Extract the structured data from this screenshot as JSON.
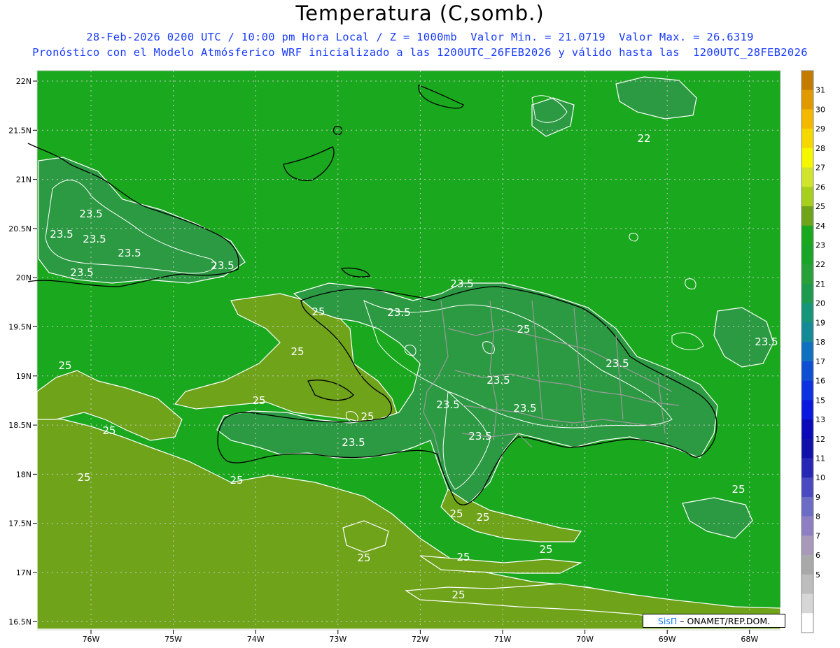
{
  "title": "Temperatura (C,somb.)",
  "subtitle_line1": "28-Feb-2026 0200 UTC / 10:00 pm Hora Local / Z = 1000mb  Valor Min. = 21.0719  Valor Max. = 26.6319",
  "subtitle_line2": "Pronóstico con el Modelo Atmósferico WRF inicializado a las 1200UTC_26FEB2026 y válido hasta las  1200UTC_28FEB2026",
  "credit": {
    "brand": "SisΠ",
    "separator": "– ",
    "org": "ONAMET/REP.DOM."
  },
  "colors": {
    "field_base": "#1aa81e",
    "field_warm": "#6fa31a",
    "field_cool": "#27a038",
    "land_cool": "#2b9a42",
    "title_blue": "#1a3cff"
  },
  "axes": {
    "lat_labels": [
      "22N",
      "21.5N",
      "21N",
      "20.5N",
      "20N",
      "19.5N",
      "19N",
      "18.5N",
      "18N",
      "17.5N",
      "17N",
      "16.5N"
    ],
    "lon_labels": [
      "76W",
      "75W",
      "74W",
      "73W",
      "72W",
      "71W",
      "70W",
      "69W",
      "68W"
    ]
  },
  "colorbar": {
    "labels": [
      31,
      30,
      29,
      28,
      27,
      26,
      25,
      24,
      23,
      22,
      21,
      20,
      19,
      18,
      17,
      16,
      15,
      13,
      12,
      11,
      10,
      9,
      8,
      7,
      6,
      5
    ],
    "colors": [
      "#c47c00",
      "#e09a00",
      "#f5b800",
      "#f5d800",
      "#f5f700",
      "#cfe42c",
      "#a6cf1e",
      "#6fa31a",
      "#1aa81e",
      "#1ba528",
      "#27a038",
      "#1e9a4f",
      "#16957a",
      "#138a96",
      "#1070c0",
      "#0e4fd2",
      "#0c32e0",
      "#0a18dd",
      "#0a0ab8",
      "#1010aa",
      "#2727b5",
      "#4949c0",
      "#6c6cc5",
      "#8e7fc2",
      "#a69ab8",
      "#a9a9a9",
      "#bdbdbd",
      "#d6d6d6",
      "#ffffff"
    ]
  },
  "chart_data": {
    "type": "heatmap",
    "variable": "Temperatura (C,somb.)",
    "valid_time": "28-Feb-2026 0200 UTC",
    "level": "1000mb",
    "min": 21.0719,
    "max": 26.6319,
    "contour_labels": [
      "23.5",
      "23.5",
      "23.5",
      "23.5",
      "23.5",
      "23.5",
      "23.5",
      "23.5",
      "23.5",
      "23.5",
      "23.5",
      "23.5",
      "23.5",
      "23.5",
      "23.5",
      "22",
      "25",
      "25",
      "25",
      "25",
      "25",
      "25",
      "25",
      "25",
      "25",
      "25",
      "25",
      "25",
      "25",
      "25",
      "25",
      "25"
    ]
  }
}
